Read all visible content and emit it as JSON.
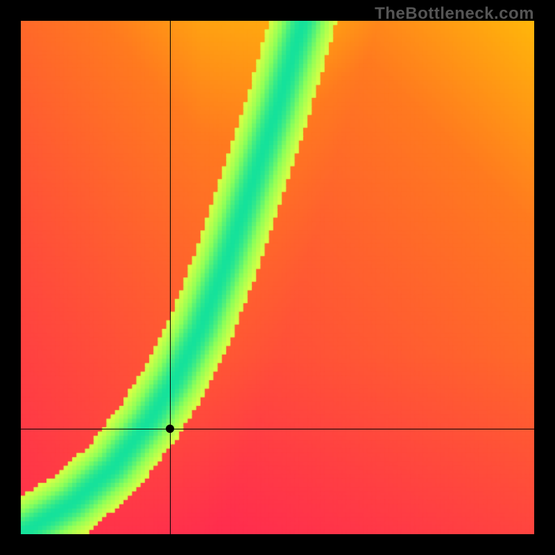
{
  "watermark": "TheBottleneck.com",
  "chart_data": {
    "type": "heatmap",
    "title": "",
    "xlabel": "",
    "ylabel": "",
    "xlim": [
      0,
      1
    ],
    "ylim": [
      0,
      1
    ],
    "crosshair": {
      "x": 0.29,
      "y": 0.205
    },
    "marker": {
      "x": 0.29,
      "y": 0.205
    },
    "ridge": [
      {
        "x": 0.0,
        "y": 0.0
      },
      {
        "x": 0.1,
        "y": 0.06
      },
      {
        "x": 0.18,
        "y": 0.13
      },
      {
        "x": 0.25,
        "y": 0.22
      },
      {
        "x": 0.3,
        "y": 0.3
      },
      {
        "x": 0.35,
        "y": 0.4
      },
      {
        "x": 0.4,
        "y": 0.53
      },
      {
        "x": 0.45,
        "y": 0.68
      },
      {
        "x": 0.5,
        "y": 0.83
      },
      {
        "x": 0.55,
        "y": 1.0
      }
    ],
    "grid_resolution": 120,
    "color_stops": [
      {
        "t": 0.0,
        "color": "#ff2e4d"
      },
      {
        "t": 0.4,
        "color": "#ff7a1f"
      },
      {
        "t": 0.62,
        "color": "#ffd400"
      },
      {
        "t": 0.78,
        "color": "#f9ff3a"
      },
      {
        "t": 0.9,
        "color": "#8cff5a"
      },
      {
        "t": 1.0,
        "color": "#15e29b"
      }
    ],
    "ridge_halfwidth": 0.038,
    "background_decay": 0.55
  }
}
